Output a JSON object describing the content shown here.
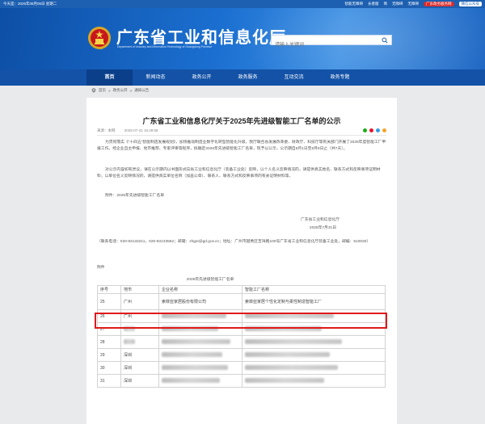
{
  "topbar": {
    "date": "今天是：2025年08月05日 星期二",
    "links": [
      "智能无障碍",
      "长者版",
      "简",
      "无障碍",
      "无障碍"
    ],
    "pill": "广东政务服务网",
    "wx": "微信公众号"
  },
  "header": {
    "title": "广东省工业和信息化厅",
    "subtitle": "Department of Industry and Information Technology of Guangdong Province"
  },
  "search": {
    "placeholder": "请输入关键词"
  },
  "nav": [
    "首页",
    "新闻动态",
    "政务公开",
    "政务服务",
    "互动交流",
    "政务专题"
  ],
  "breadcrumb": [
    "首页",
    "政务公开",
    "通知公告"
  ],
  "article": {
    "title": "广东省工业和信息化厅关于2025年先进级智能工厂名单的公示",
    "source": "来源：本网",
    "date": "2025-07-31 15:49:58",
    "para1": "为贯彻落实《“十四五”智能制造发展规划》，加快推动制造业数字化转型智能化升级，我厅联合省发展改革委、财政厅、科技厅等有关部门开展了2025年度智能工厂申报工作。经企业自主申报、地市推荐、专家评审等程序，拟确定2025年先进级智能工厂名单，现予以公示，公示期自8月1日至8月8日止（共7天）。",
    "para2": "对公示内容如有异议，请在公示期内以书面形式向省工业和信息化厅（装备工业处）反映，以个人名义反映情况的，请提供真实姓名、联系方式和反映事项证明材料；以单位名义反映情况的，请提供真实单位名称（加盖公章）、联系人、联系方式和反映事项的有关证明材料等。",
    "attach": "附件：2025年先进级智能工厂名单",
    "org": "广东省工业和信息化厅",
    "signdate": "2025年7月31日",
    "contact": "（联系电话：020-83133211，020-83133562；邮箱：zhgxt@gd.gov.cn；地址：广州市越秀区吉祥路100号广东省工业和信息化厅装备工业处，邮编：510030）",
    "attach_head": "附件",
    "table_caption": "2025年先进级智能工厂名单"
  },
  "table": {
    "headers": [
      "序号",
      "地市",
      "企业名称",
      "智能工厂名称"
    ],
    "rows": [
      {
        "no": "25",
        "city": "广州",
        "company": "索菲亚家居股份有限公司",
        "factory": "索菲亚家居个性化定制与柔性制造智能工厂"
      },
      {
        "no": "26",
        "city": "广州",
        "company": "",
        "factory": ""
      },
      {
        "no": "27",
        "city": "",
        "company": "",
        "factory": ""
      },
      {
        "no": "28",
        "city": "",
        "company": "",
        "factory": ""
      },
      {
        "no": "29",
        "city": "深圳",
        "company": "",
        "factory": ""
      },
      {
        "no": "30",
        "city": "深圳",
        "company": "",
        "factory": ""
      },
      {
        "no": "31",
        "city": "深圳",
        "company": "",
        "factory": ""
      }
    ]
  },
  "colors": {
    "brand": "#1352a7",
    "highlight": "#e0191b"
  }
}
